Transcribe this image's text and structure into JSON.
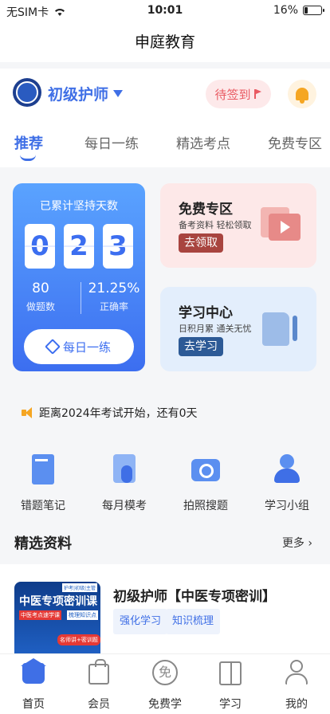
{
  "status": {
    "carrier": "无SIM卡",
    "time": "10:01",
    "battery": "16%",
    "battery_level": 0.16
  },
  "nav": {
    "title": "申庭教育"
  },
  "header": {
    "exam": "初级护师",
    "checkin": "待签到",
    "tabs": [
      "推荐",
      "每日一练",
      "精选考点",
      "免费专区"
    ]
  },
  "main_card": {
    "title": "已累计坚持天数",
    "digits": [
      "0",
      "2",
      "3"
    ],
    "done_value": "80",
    "done_label": "做题数",
    "accuracy_value": "21.25%",
    "accuracy_label": "正确率",
    "button": "每日一练"
  },
  "free_card": {
    "title": "免费专区",
    "subtitle": "备考资料 轻松领取",
    "button": "去领取"
  },
  "study_card": {
    "title": "学习中心",
    "subtitle": "日积月累 通关无忧",
    "button": "去学习"
  },
  "notice": "距离2024年考试开始，还有0天",
  "quick": [
    "错题笔记",
    "每月模考",
    "拍照搜题",
    "学习小组"
  ],
  "section": {
    "title": "精选资料",
    "more": "更多"
  },
  "course": {
    "title": "初级护师【中医专项密训】",
    "tags": [
      "强化学习",
      "知识梳理"
    ],
    "cover_text": "中医专项密训课",
    "cover_tag1": "中医考点速学课",
    "cover_tag2": "梳理知识点",
    "cover_top": "护考|初级|主管",
    "cover_badge": "名师讲+密训题"
  },
  "tabbar": [
    "首页",
    "会员",
    "免费学",
    "学习",
    "我的"
  ],
  "colors": {
    "accent": "#3f6fe6",
    "checkin": "#e95a62",
    "bell": "#f5a623"
  }
}
